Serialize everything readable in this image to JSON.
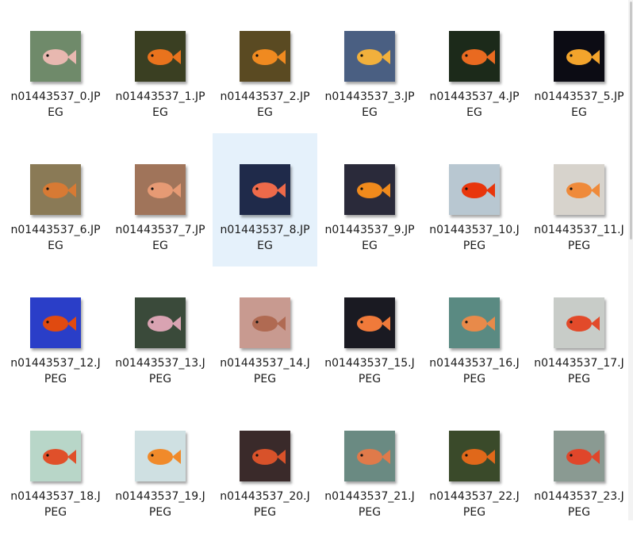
{
  "files": [
    {
      "line1": "n01443537_0.JP",
      "line2": "EG",
      "bg": "#6f8a6a",
      "fish": "#e8b8b0",
      "selected": false
    },
    {
      "line1": "n01443537_1.JP",
      "line2": "EG",
      "bg": "#3a3f22",
      "fish": "#e9731d",
      "selected": false
    },
    {
      "line1": "n01443537_2.JP",
      "line2": "EG",
      "bg": "#5a4a22",
      "fish": "#f08a20",
      "selected": false
    },
    {
      "line1": "n01443537_3.JP",
      "line2": "EG",
      "bg": "#4a5f82",
      "fish": "#f1b03c",
      "selected": false
    },
    {
      "line1": "n01443537_4.JP",
      "line2": "EG",
      "bg": "#1c2a1a",
      "fish": "#e96a20",
      "selected": false
    },
    {
      "line1": "n01443537_5.JP",
      "line2": "EG",
      "bg": "#0c0c14",
      "fish": "#f3a42c",
      "selected": false
    },
    {
      "line1": "n01443537_6.JP",
      "line2": "EG",
      "bg": "#8a7a56",
      "fish": "#d77a34",
      "selected": false
    },
    {
      "line1": "n01443537_7.JP",
      "line2": "EG",
      "bg": "#a0745a",
      "fish": "#e69a74",
      "selected": false
    },
    {
      "line1": "n01443537_8.JP",
      "line2": "EG",
      "bg": "#1f2a4a",
      "fish": "#ee6a4a",
      "selected": true
    },
    {
      "line1": "n01443537_9.JP",
      "line2": "EG",
      "bg": "#2a2a3a",
      "fish": "#f08a1c",
      "selected": false
    },
    {
      "line1": "n01443537_10.J",
      "line2": "PEG",
      "bg": "#b8c7d1",
      "fish": "#e8360c",
      "selected": false
    },
    {
      "line1": "n01443537_11.J",
      "line2": "PEG",
      "bg": "#d7d3cc",
      "fish": "#ef8a3a",
      "selected": false
    },
    {
      "line1": "n01443537_12.J",
      "line2": "PEG",
      "bg": "#2a3ec8",
      "fish": "#e04a10",
      "selected": false
    },
    {
      "line1": "n01443537_13.J",
      "line2": "PEG",
      "bg": "#3a4a3a",
      "fish": "#d9a3b2",
      "selected": false
    },
    {
      "line1": "n01443537_14.J",
      "line2": "PEG",
      "bg": "#c89a90",
      "fish": "#b06a52",
      "selected": false
    },
    {
      "line1": "n01443537_15.J",
      "line2": "PEG",
      "bg": "#1a1a22",
      "fish": "#f07a3a",
      "selected": false
    },
    {
      "line1": "n01443537_16.J",
      "line2": "PEG",
      "bg": "#5a8a82",
      "fish": "#e88a4a",
      "selected": false
    },
    {
      "line1": "n01443537_17.J",
      "line2": "PEG",
      "bg": "#c8ccc8",
      "fish": "#e24a2a",
      "selected": false
    },
    {
      "line1": "n01443537_18.J",
      "line2": "PEG",
      "bg": "#b8d6c8",
      "fish": "#e0502a",
      "selected": false
    },
    {
      "line1": "n01443537_19.J",
      "line2": "PEG",
      "bg": "#cfe0e2",
      "fish": "#f08a2a",
      "selected": false
    },
    {
      "line1": "n01443537_20.J",
      "line2": "PEG",
      "bg": "#3a2a2a",
      "fish": "#d8522a",
      "selected": false
    },
    {
      "line1": "n01443537_21.J",
      "line2": "PEG",
      "bg": "#6a8a82",
      "fish": "#e07a4a",
      "selected": false
    },
    {
      "line1": "n01443537_22.J",
      "line2": "PEG",
      "bg": "#3a4a2a",
      "fish": "#e0681a",
      "selected": false
    },
    {
      "line1": "n01443537_23.J",
      "line2": "PEG",
      "bg": "#8a9a92",
      "fish": "#e0462a",
      "selected": false
    }
  ]
}
